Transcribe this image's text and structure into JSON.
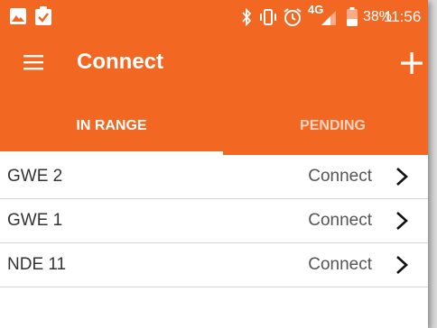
{
  "status_bar": {
    "network": "4G",
    "battery": "38%",
    "time": "11:56"
  },
  "app_bar": {
    "title": "Connect"
  },
  "tabs": [
    {
      "label": "IN RANGE",
      "active": true
    },
    {
      "label": "PENDING",
      "active": false
    }
  ],
  "devices": [
    {
      "name": "GWE 2",
      "action": "Connect"
    },
    {
      "name": "GWE 1",
      "action": "Connect"
    },
    {
      "name": "NDE 11",
      "action": "Connect"
    }
  ],
  "colors": {
    "accent": "#f26722",
    "tab_indicator": "#ffffff"
  },
  "icons": {
    "menu": "hamburger-menu-icon",
    "add": "plus-icon",
    "row_chevron": "chevron-right-icon"
  }
}
